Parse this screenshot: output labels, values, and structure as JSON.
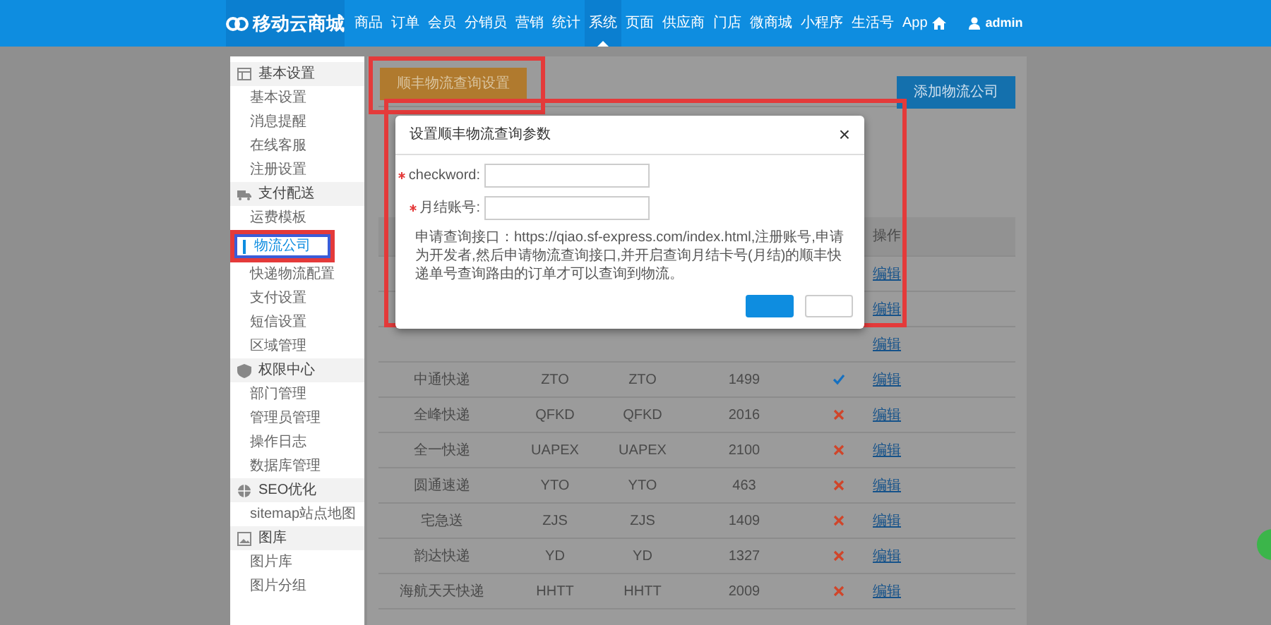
{
  "brand": "移动云商城",
  "nav": [
    {
      "label": "商品",
      "selected": false
    },
    {
      "label": "订单",
      "selected": false
    },
    {
      "label": "会员",
      "selected": false
    },
    {
      "label": "分销员",
      "selected": false
    },
    {
      "label": "营销",
      "selected": false
    },
    {
      "label": "统计",
      "selected": false
    },
    {
      "label": "系统",
      "selected": true
    },
    {
      "label": "页面",
      "selected": false
    },
    {
      "label": "供应商",
      "selected": false
    },
    {
      "label": "门店",
      "selected": false
    },
    {
      "label": "微商城",
      "selected": false
    },
    {
      "label": "小程序",
      "selected": false
    },
    {
      "label": "生活号",
      "selected": false
    },
    {
      "label": "App",
      "selected": false
    }
  ],
  "user": "admin",
  "sidebar": [
    {
      "title": "基本设置",
      "items": [
        {
          "label": "基本设置",
          "selected": false
        },
        {
          "label": "消息提醒",
          "selected": false
        },
        {
          "label": "在线客服",
          "selected": false
        },
        {
          "label": "注册设置",
          "selected": false
        }
      ]
    },
    {
      "title": "支付配送",
      "items": [
        {
          "label": "运费模板",
          "selected": false
        },
        {
          "label": "物流公司",
          "selected": true
        },
        {
          "label": "快递物流配置",
          "selected": false
        },
        {
          "label": "支付设置",
          "selected": false
        },
        {
          "label": "短信设置",
          "selected": false
        },
        {
          "label": "区域管理",
          "selected": false
        }
      ]
    },
    {
      "title": "权限中心",
      "items": [
        {
          "label": "部门管理",
          "selected": false
        },
        {
          "label": "管理员管理",
          "selected": false
        },
        {
          "label": "操作日志",
          "selected": false
        },
        {
          "label": "数据库管理",
          "selected": false
        }
      ]
    },
    {
      "title": "SEO优化",
      "items": [
        {
          "label": "sitemap站点地图",
          "selected": false
        }
      ]
    },
    {
      "title": "图库",
      "items": [
        {
          "label": "图片库",
          "selected": false
        },
        {
          "label": "图片分组",
          "selected": false
        }
      ]
    }
  ],
  "buttons": {
    "left": "顺丰物流查询设置",
    "right": "添加物流公司"
  },
  "table": {
    "action_header": "操作",
    "rows": [
      {
        "action": "编辑"
      },
      {
        "action": "编辑"
      },
      {
        "action": "编辑"
      },
      {
        "name": "中通快递",
        "code": "ZTO",
        "code2": "ZTO",
        "number": "1499",
        "enabled": true,
        "action": "编辑"
      },
      {
        "name": "全峰快递",
        "code": "QFKD",
        "code2": "QFKD",
        "number": "2016",
        "enabled": false,
        "action": "编辑"
      },
      {
        "name": "全一快递",
        "code": "UAPEX",
        "code2": "UAPEX",
        "number": "2100",
        "enabled": false,
        "action": "编辑"
      },
      {
        "name": "圆通速递",
        "code": "YTO",
        "code2": "YTO",
        "number": "463",
        "enabled": false,
        "action": "编辑"
      },
      {
        "name": "宅急送",
        "code": "ZJS",
        "code2": "ZJS",
        "number": "1409",
        "enabled": false,
        "action": "编辑"
      },
      {
        "name": "韵达快递",
        "code": "YD",
        "code2": "YD",
        "number": "1327",
        "enabled": false,
        "action": "编辑"
      },
      {
        "name": "海航天天快递",
        "code": "HHTT",
        "code2": "HHTT",
        "number": "2009",
        "enabled": false,
        "action": "编辑"
      }
    ]
  },
  "modal": {
    "title": "设置顺丰物流查询参数",
    "close": "×",
    "fields": [
      {
        "label": "checkword:",
        "required": true
      },
      {
        "label": "月结账号:",
        "required": true
      }
    ],
    "help_prefix": "申请查询接口：",
    "help_link": "https://qiao.sf-express.com/index.html",
    "help_rest": ",注册账号,申请为开发者,然后申请物流查询接口,并开启查询月结卡号(月结)的顺丰快递单号查询路由的订单才可以查询到物流。"
  }
}
